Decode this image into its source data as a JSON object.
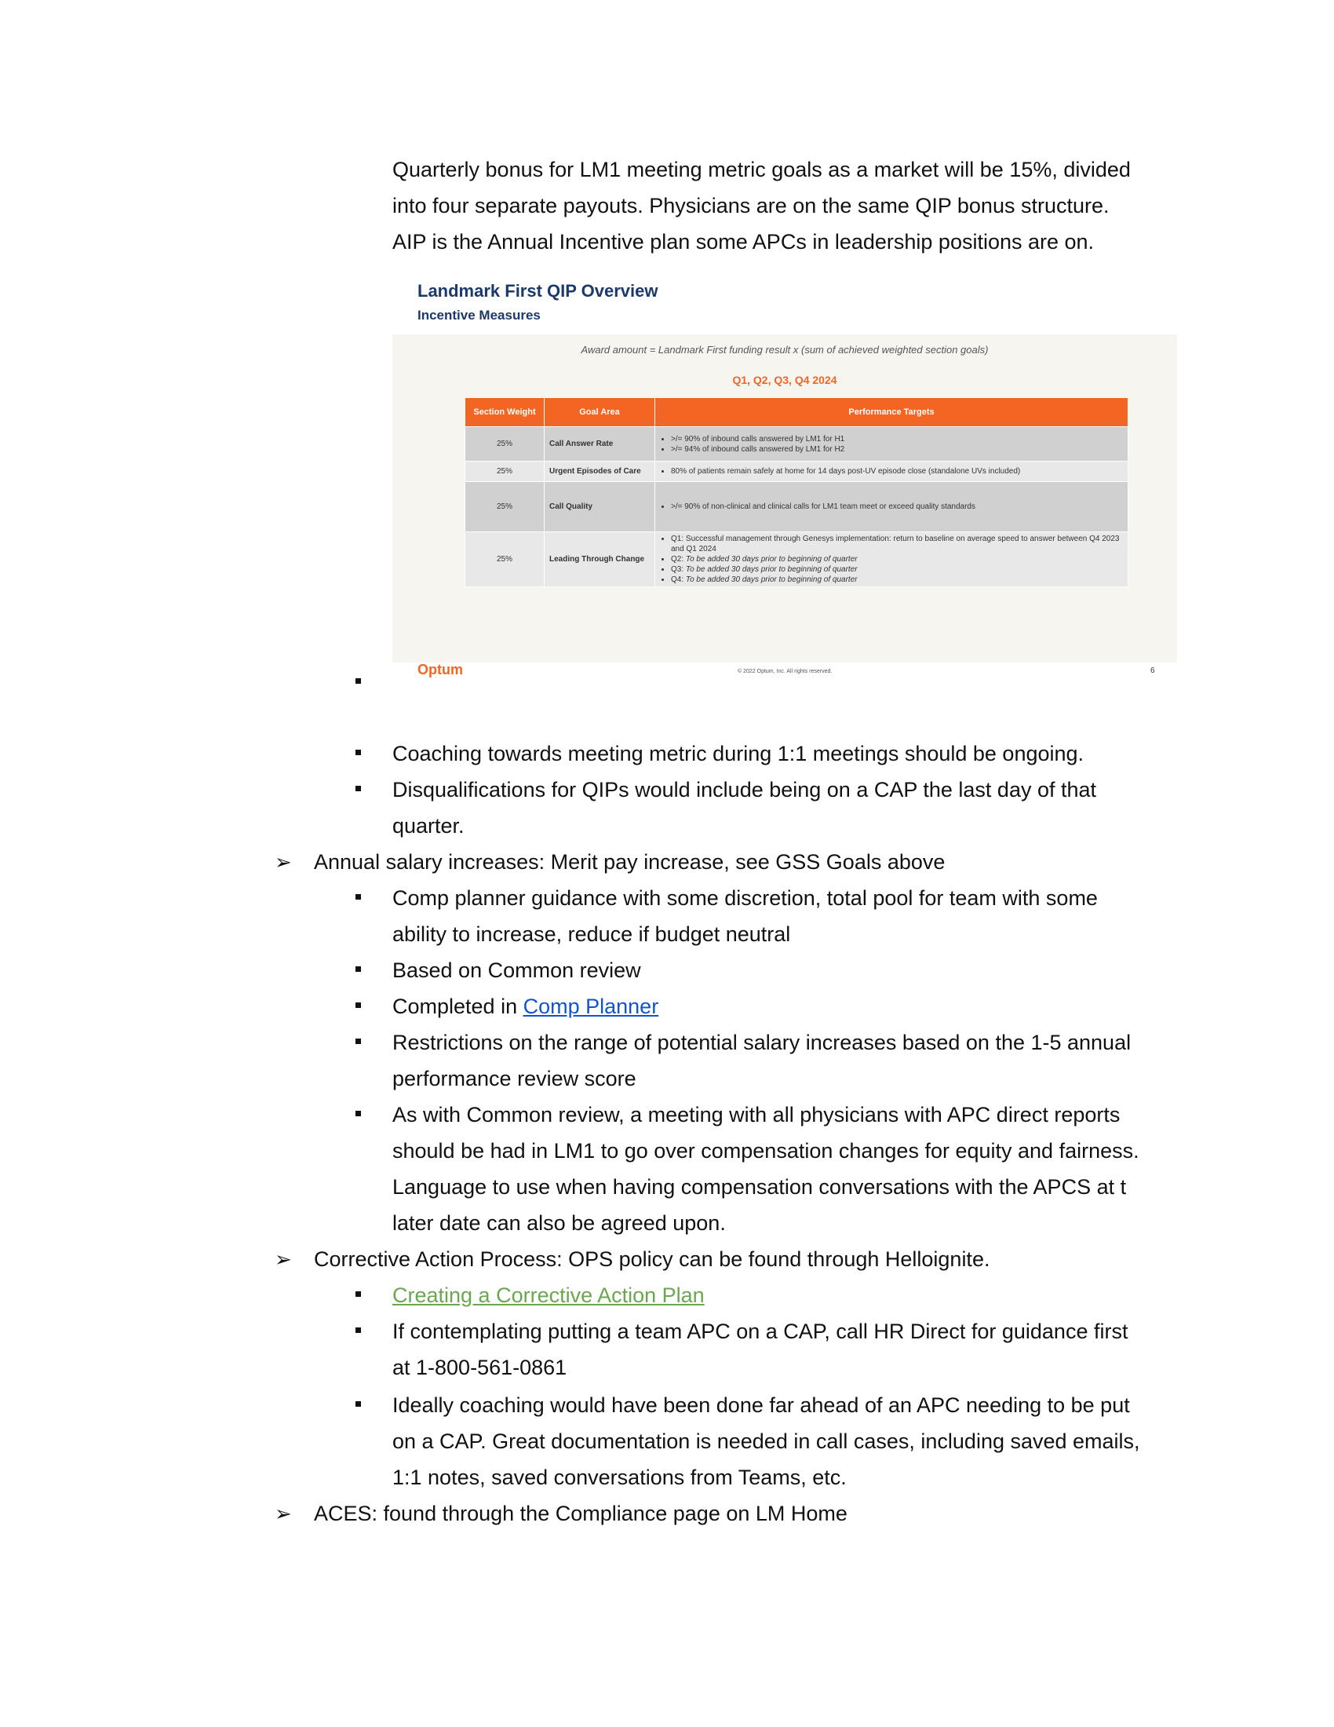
{
  "intro": [
    "Quarterly bonus for LM1 meeting metric goals as a market will be 15%, divided",
    "into four separate payouts. Physicians are on the same QIP bonus structure.",
    "AIP is the Annual Incentive plan some APCs in leadership positions are on."
  ],
  "slide": {
    "title": "Landmark First QIP Overview",
    "subtitle": "Incentive Measures",
    "formula": "Award amount = Landmark First funding result x (sum of achieved weighted section goals)",
    "quarters": "Q1, Q2, Q3, Q4 2024",
    "headers": [
      "Section Weight",
      "Goal Area",
      "Performance Targets"
    ],
    "rows": [
      {
        "weight": "25%",
        "goal": "Call Answer Rate",
        "targets": [
          ">/= 90% of inbound calls answered by LM1 for H1",
          ">/= 94% of inbound calls answered by LM1 for H2"
        ]
      },
      {
        "weight": "25%",
        "goal": "Urgent Episodes of Care",
        "targets": [
          "80% of patients remain safely at home for 14 days post-UV episode close (standalone UVs included)"
        ]
      },
      {
        "weight": "25%",
        "goal": "Call Quality",
        "targets": [
          ">/= 90% of non-clinical and clinical calls for LM1 team meet or exceed quality standards"
        ]
      },
      {
        "weight": "25%",
        "goal": "Leading Through Change",
        "targets": [
          {
            "label": "Q1:",
            "text": "Successful management through Genesys implementation: return to baseline on average speed to answer between Q4 2023 and Q1 2024"
          },
          {
            "label": "Q2:",
            "text": "To be added 30 days prior to beginning of quarter"
          },
          {
            "label": "Q3:",
            "text": "To be added 30 days prior to beginning of quarter"
          },
          {
            "label": "Q4:",
            "text": "To be added 30 days prior to beginning of quarter"
          }
        ]
      }
    ],
    "logo": "Optum",
    "copyright": "© 2022 Optum, Inc. All rights reserved.",
    "page_number": "6"
  },
  "bullets_a": [
    "Coaching towards meeting metric during 1:1 meetings should be ongoing.",
    "Disqualifications for QIPs would include being on a CAP the last day of that",
    "quarter."
  ],
  "salary": {
    "heading": "Annual salary increases: Merit pay increase, see GSS Goals above",
    "items": [
      "Comp planner guidance with some discretion, total pool for team with some",
      "ability to increase, reduce if budget neutral",
      "Based on Common review",
      "Completed in ",
      "Comp Planner ",
      "Restrictions on the range of potential salary increases based on the 1-5 annual",
      "performance review score",
      "As with Common review, a meeting with all physicians with APC direct reports",
      "should be had in LM1 to go over compensation changes for equity and fairness.",
      "Language to use when having compensation conversations with the APCS at t",
      "later date can also be agreed upon."
    ]
  },
  "corrective": {
    "heading": "Corrective Action Process: OPS policy can be found through Helloignite.",
    "link": "Creating a Corrective Action Plan",
    "items": [
      "If contemplating putting a team APC on a CAP, call HR Direct for guidance first",
      "at 1-800-561-0861",
      "Ideally coaching would have been done far ahead of an APC needing to be put",
      "on a CAP.  Great documentation is needed in call cases, including saved emails,",
      "1:1 notes, saved conversations from Teams, etc."
    ]
  },
  "aces": "ACES: found through the Compliance page on LM Home",
  "icons": {
    "bullet": "square-bullet-icon",
    "arrow": "arrow-bullet-icon"
  },
  "colors": {
    "link_blue": "#1155cc",
    "link_green": "#6aa84f",
    "accent_orange": "#f26522",
    "slide_navy": "#1b3a6b"
  }
}
